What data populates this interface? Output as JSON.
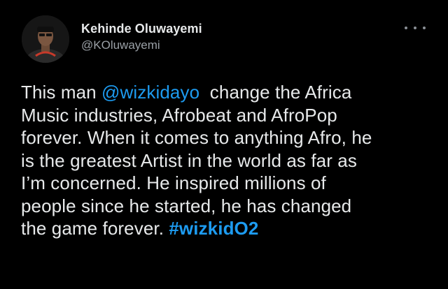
{
  "author": {
    "display_name": "Kehinde Oluwayemi",
    "handle": "@KOluwayemi"
  },
  "more_icon": "more-horizontal-icon",
  "tweet": {
    "line1_before": "This man ",
    "mention": "@wizkidayo",
    "line1_after": "  change the Africa",
    "line2": "Music industries, Afrobeat and AfroPop",
    "line3": "forever. When it comes to anything Afro, he",
    "line4": "is the greatest Artist in the world as far as",
    "line5": "I’m concerned. He inspired millions of",
    "line6": "people since he started, he has changed",
    "line7_before": "the game forever. ",
    "hashtag": "#wizkidO2"
  },
  "colors": {
    "background": "#000000",
    "text": "#e7e9ea",
    "secondary": "#9aa0a6",
    "accent": "#1d9bf0"
  }
}
